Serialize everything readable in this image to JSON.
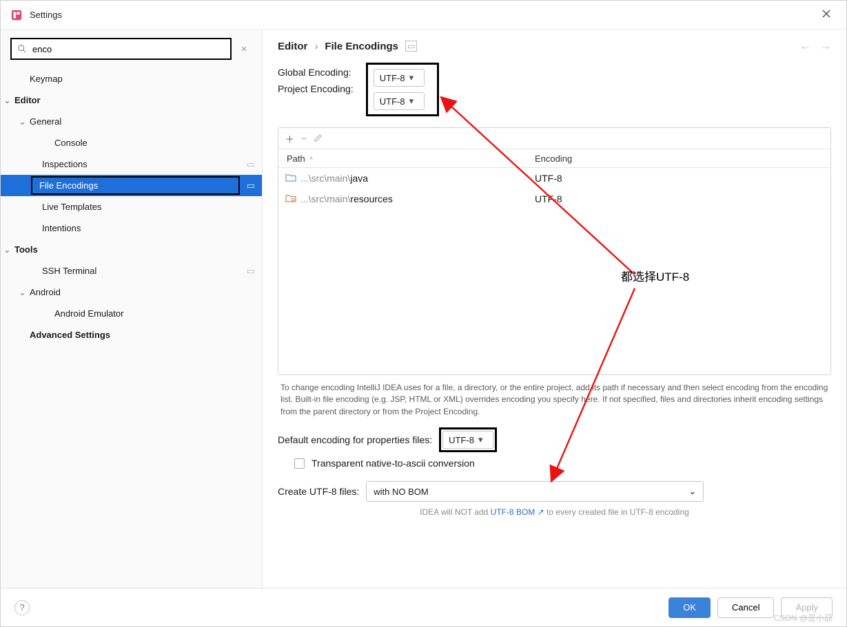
{
  "titlebar": {
    "title": "Settings"
  },
  "sidebar": {
    "search": "enco",
    "items": [
      {
        "label": "Keymap"
      },
      {
        "label": "Editor"
      },
      {
        "label": "General"
      },
      {
        "label": "Console"
      },
      {
        "label": "Inspections"
      },
      {
        "label": "File Encodings"
      },
      {
        "label": "Live Templates"
      },
      {
        "label": "Intentions"
      },
      {
        "label": "Tools"
      },
      {
        "label": "SSH Terminal"
      },
      {
        "label": "Android"
      },
      {
        "label": "Android Emulator"
      },
      {
        "label": "Advanced Settings"
      }
    ]
  },
  "breadcrumb": {
    "a": "Editor",
    "b": "File Encodings"
  },
  "encodings": {
    "global_label": "Global Encoding:",
    "global_value": "UTF-8",
    "project_label": "Project Encoding:",
    "project_value": "UTF-8"
  },
  "table": {
    "col_path": "Path",
    "col_enc": "Encoding",
    "rows": [
      {
        "prefix": "...\\src\\main\\",
        "name": "java",
        "encoding": "UTF-8"
      },
      {
        "prefix": "...\\src\\main\\",
        "name": "resources",
        "encoding": "UTF-8"
      }
    ]
  },
  "desc": "To change encoding IntelliJ IDEA uses for a file, a directory, or the entire project, add its path if necessary and then select encoding from the encoding list. Built-in file encoding (e.g. JSP, HTML or XML) overrides encoding you specify here. If not specified, files and directories inherit encoding settings from the parent directory or from the Project Encoding.",
  "props": {
    "label": "Default encoding for properties files:",
    "value": "UTF-8",
    "checkbox_label": "Transparent native-to-ascii conversion"
  },
  "create": {
    "label": "Create UTF-8 files:",
    "value": "with NO BOM",
    "hint_pre": "IDEA will NOT add ",
    "hint_link": "UTF-8 BOM",
    "hint_post": " to every created file in UTF-8 encoding"
  },
  "footer": {
    "ok": "OK",
    "cancel": "Cancel",
    "apply": "Apply"
  },
  "annotation": "都选择UTF-8",
  "watermark": "CSDN @是小辰"
}
